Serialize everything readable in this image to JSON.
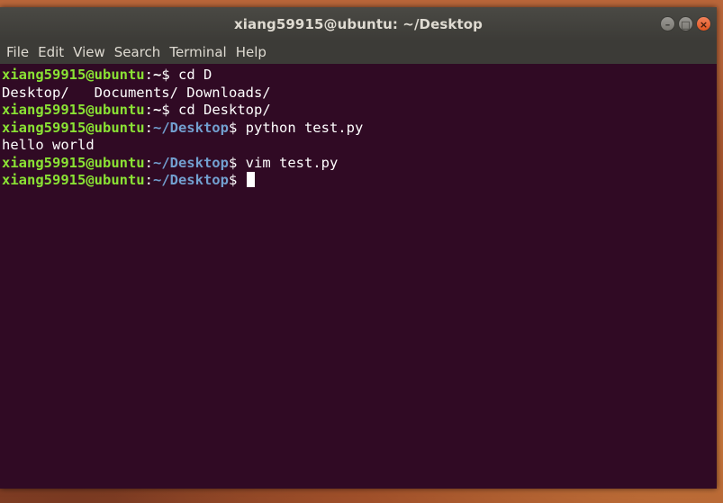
{
  "window": {
    "title": "xiang59915@ubuntu: ~/Desktop",
    "controls": [
      "minimize",
      "maximize",
      "close"
    ]
  },
  "menubar": {
    "items": [
      "File",
      "Edit",
      "View",
      "Search",
      "Terminal",
      "Help"
    ]
  },
  "terminal": {
    "colors": {
      "background": "#300a24",
      "user": "#8ae234",
      "path": "#729fcf",
      "text": "#ffffff"
    },
    "lines": [
      {
        "type": "prompt",
        "user": "xiang59915@ubuntu",
        "path": "~",
        "command": "cd D"
      },
      {
        "type": "output",
        "text": "Desktop/   Documents/ Downloads/"
      },
      {
        "type": "prompt",
        "user": "xiang59915@ubuntu",
        "path": "~",
        "command": "cd Desktop/"
      },
      {
        "type": "prompt",
        "user": "xiang59915@ubuntu",
        "path": "~/Desktop",
        "command": "python test.py"
      },
      {
        "type": "output",
        "text": "hello world"
      },
      {
        "type": "prompt",
        "user": "xiang59915@ubuntu",
        "path": "~/Desktop",
        "command": "vim test.py"
      },
      {
        "type": "prompt",
        "user": "xiang59915@ubuntu",
        "path": "~/Desktop",
        "command": ""
      }
    ],
    "cursor": "block"
  }
}
